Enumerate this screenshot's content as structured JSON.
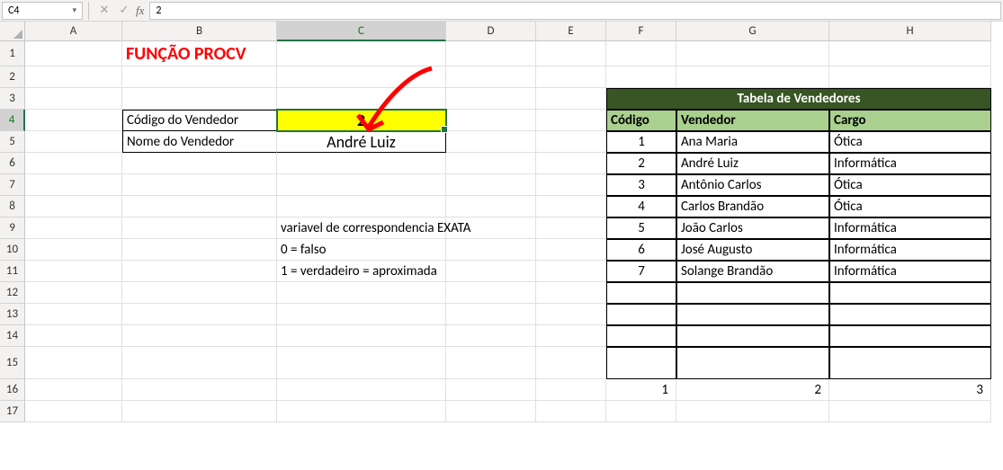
{
  "namebox": {
    "ref": "C4"
  },
  "formula_bar": {
    "fx_label": "fx",
    "value": "2"
  },
  "col_letters": [
    "A",
    "B",
    "C",
    "D",
    "E",
    "F",
    "G",
    "H"
  ],
  "row_numbers": [
    1,
    2,
    3,
    4,
    5,
    6,
    7,
    8,
    9,
    10,
    11,
    12,
    13,
    14,
    15,
    16,
    17
  ],
  "title": "FUNÇÃO PROCV",
  "input_box": {
    "codigo_label": "Código do Vendedor",
    "codigo_value": "2",
    "nome_label": "Nome do Vendedor",
    "nome_value": "André Luiz"
  },
  "notes": {
    "l1": "variavel de correspondencia EXATA",
    "l2": "0 = falso",
    "l3": "1 = verdadeiro = aproximada"
  },
  "table": {
    "title": "Tabela de Vendedores",
    "headers": [
      "Código",
      "Vendedor",
      "Cargo"
    ],
    "rows": [
      {
        "codigo": "1",
        "vendedor": "Ana Maria",
        "cargo": "Ótica"
      },
      {
        "codigo": "2",
        "vendedor": "André Luiz",
        "cargo": "Informática"
      },
      {
        "codigo": "3",
        "vendedor": "Antônio Carlos",
        "cargo": "Ótica"
      },
      {
        "codigo": "4",
        "vendedor": "Carlos Brandão",
        "cargo": "Ótica"
      },
      {
        "codigo": "5",
        "vendedor": "João Carlos",
        "cargo": "Informática"
      },
      {
        "codigo": "6",
        "vendedor": "José Augusto",
        "cargo": "Informática"
      },
      {
        "codigo": "7",
        "vendedor": "Solange Brandão",
        "cargo": "Informática"
      }
    ]
  },
  "bottom_row": [
    "1",
    "2",
    "3"
  ]
}
